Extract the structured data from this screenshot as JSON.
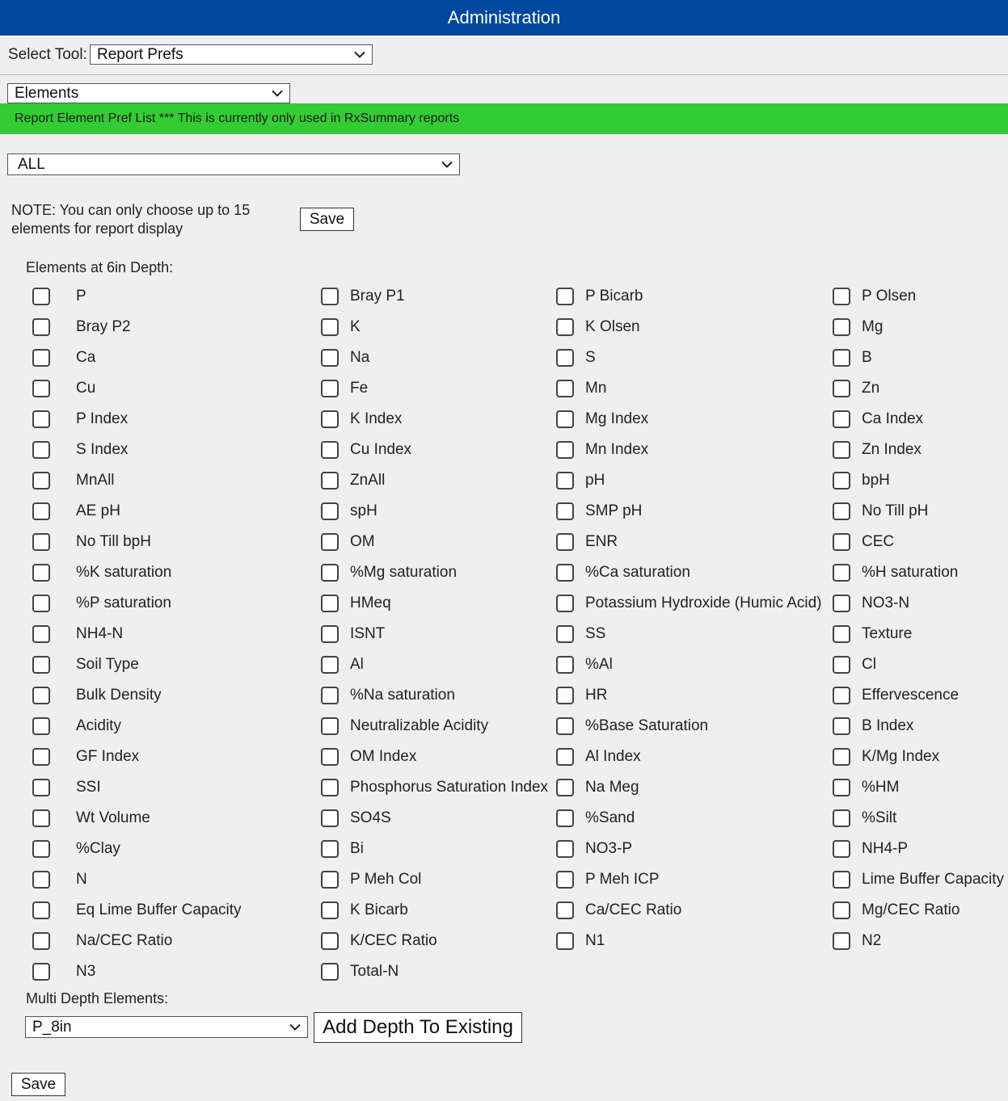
{
  "header": {
    "title": "Administration"
  },
  "tool_select": {
    "label": "Select Tool:",
    "value": "Report Prefs"
  },
  "category_select": {
    "value": "Elements"
  },
  "banner": {
    "text": "Report Element Pref List *** This is currently only used in RxSummary reports"
  },
  "filter_select": {
    "value": "ALL"
  },
  "note": {
    "line1": "NOTE: You can only choose up to 15",
    "line2": "elements for report display"
  },
  "save_top_label": "Save",
  "section_title": "Elements at 6in Depth:",
  "elements": [
    [
      "P",
      "Bray P1",
      "P Bicarb",
      "P Olsen"
    ],
    [
      "Bray P2",
      "K",
      "K Olsen",
      "Mg"
    ],
    [
      "Ca",
      "Na",
      "S",
      "B"
    ],
    [
      "Cu",
      "Fe",
      "Mn",
      "Zn"
    ],
    [
      "P Index",
      "K Index",
      "Mg Index",
      "Ca Index"
    ],
    [
      "S Index",
      "Cu Index",
      "Mn Index",
      "Zn Index"
    ],
    [
      "MnAll",
      "ZnAll",
      "pH",
      "bpH"
    ],
    [
      "AE pH",
      "spH",
      "SMP pH",
      "No Till pH"
    ],
    [
      "No Till bpH",
      "OM",
      "ENR",
      "CEC"
    ],
    [
      "%K saturation",
      "%Mg saturation",
      "%Ca saturation",
      "%H saturation"
    ],
    [
      "%P saturation",
      "HMeq",
      "Potassium Hydroxide (Humic Acid)",
      "NO3-N"
    ],
    [
      "NH4-N",
      "ISNT",
      "SS",
      "Texture"
    ],
    [
      "Soil Type",
      "Al",
      "%Al",
      "Cl"
    ],
    [
      "Bulk Density",
      "%Na saturation",
      "HR",
      "Effervescence"
    ],
    [
      "Acidity",
      "Neutralizable Acidity",
      "%Base Saturation",
      "B Index"
    ],
    [
      "GF Index",
      "OM Index",
      "Al Index",
      "K/Mg Index"
    ],
    [
      "SSI",
      "Phosphorus Saturation Index",
      "Na Meg",
      "%HM"
    ],
    [
      "Wt Volume",
      "SO4S",
      "%Sand",
      "%Silt"
    ],
    [
      "%Clay",
      "Bi",
      "NO3-P",
      "NH4-P"
    ],
    [
      "N",
      "P Meh Col",
      "P Meh ICP",
      "Lime Buffer Capacity"
    ],
    [
      "Eq Lime Buffer Capacity",
      "K Bicarb",
      "Ca/CEC Ratio",
      "Mg/CEC Ratio"
    ],
    [
      "Na/CEC Ratio",
      "K/CEC Ratio",
      "N1",
      "N2"
    ],
    [
      "N3",
      "Total-N"
    ]
  ],
  "multi_depth": {
    "label": "Multi Depth Elements:",
    "select_value": "P_8in",
    "add_button": "Add Depth To Existing"
  },
  "save_bottom_label": "Save",
  "colors": {
    "header_bg": "#0047a0",
    "banner_bg": "#33cc33",
    "page_bg": "#efefef"
  }
}
